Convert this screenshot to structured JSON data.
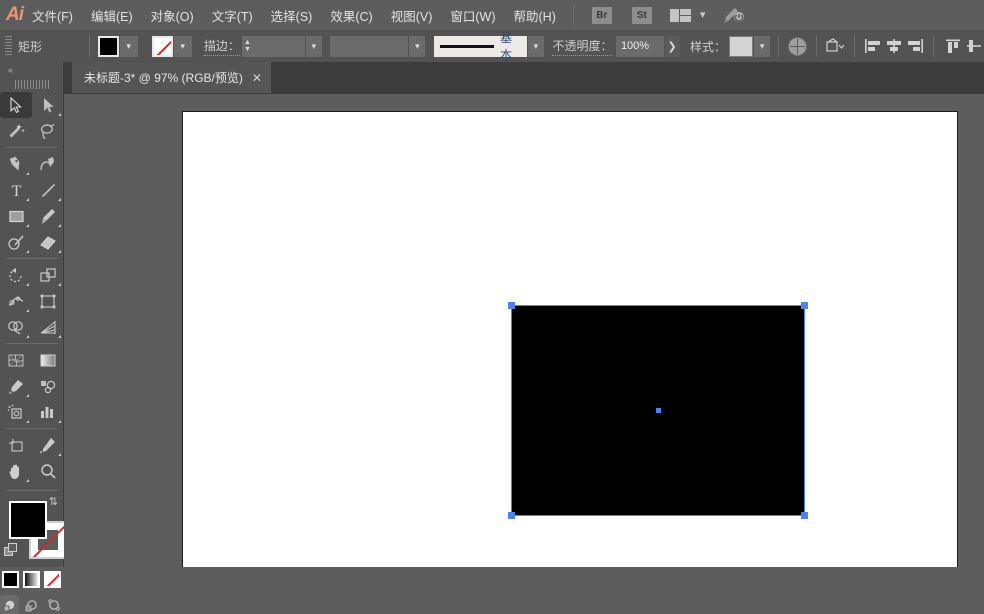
{
  "app": {
    "name": "Ai",
    "logo_color": "#e8956d"
  },
  "menubar": {
    "items": [
      {
        "label": "文件(F)",
        "name": "menu-file"
      },
      {
        "label": "编辑(E)",
        "name": "menu-edit"
      },
      {
        "label": "对象(O)",
        "name": "menu-object"
      },
      {
        "label": "文字(T)",
        "name": "menu-type"
      },
      {
        "label": "选择(S)",
        "name": "menu-select"
      },
      {
        "label": "效果(C)",
        "name": "menu-effect"
      },
      {
        "label": "视图(V)",
        "name": "menu-view"
      },
      {
        "label": "窗口(W)",
        "name": "menu-window"
      },
      {
        "label": "帮助(H)",
        "name": "menu-help"
      }
    ],
    "bridge_label": "Br",
    "stock_label": "St",
    "arrange_icon": "arrange-documents-icon",
    "chevron_icon": "chevron-down-icon",
    "rocket_icon": "rocket-power-icon"
  },
  "controlbar": {
    "grip_icon": "panel-grip-icon",
    "object_label": "矩形",
    "fill_swatch": {
      "name": "fill-color-swatch",
      "color": "#000000"
    },
    "stroke_swatch": {
      "name": "stroke-color-swatch",
      "color": "none"
    },
    "stroke_label": "描边：",
    "stroke_weight_value": "",
    "brush_label": "基本",
    "opacity_label": "不透明度：",
    "opacity_value": "100%",
    "opacity_more_icon": "chevron-right-icon",
    "style_label": "样式：",
    "style_swatch_color": "#d4d4d4",
    "recolor_icon": "recolor-artwork-icon",
    "transform_icon": "transform-shape-icon",
    "align_left_icon": "align-left-icon",
    "align_center_h_icon": "align-center-horizontal-icon",
    "align_right_icon": "align-right-icon",
    "align_top_icon": "align-top-icon",
    "align_center_v_icon": "align-center-vertical-icon",
    "dropdown_icon": "chevron-down-icon",
    "stepper_icon": "stepper-up-down-icon"
  },
  "tabs": [
    {
      "title": "未标题-3* @ 97% (RGB/预览)",
      "close_label": "✕",
      "active": true
    }
  ],
  "toolbar": {
    "collapse_icon": "double-chevron-left-icon",
    "grip_icon": "toolbar-grip-icon",
    "tools": [
      {
        "name": "tool-selection",
        "label": "选择工具",
        "active": true,
        "has_flyout": false
      },
      {
        "name": "tool-direct-selection",
        "label": "直接选择工具",
        "active": false,
        "has_flyout": true
      },
      {
        "name": "tool-magic-wand",
        "label": "魔棒工具",
        "active": false,
        "has_flyout": false
      },
      {
        "name": "tool-lasso",
        "label": "套索工具",
        "active": false,
        "has_flyout": false
      },
      {
        "name": "tool-pen",
        "label": "钢笔工具",
        "active": false,
        "has_flyout": true
      },
      {
        "name": "tool-curvature",
        "label": "曲率工具",
        "active": false,
        "has_flyout": false
      },
      {
        "name": "tool-type",
        "label": "文字工具",
        "active": false,
        "has_flyout": true
      },
      {
        "name": "tool-line-segment",
        "label": "直线段工具",
        "active": false,
        "has_flyout": true
      },
      {
        "name": "tool-rectangle",
        "label": "矩形工具",
        "active": false,
        "has_flyout": true
      },
      {
        "name": "tool-paintbrush",
        "label": "画笔工具",
        "active": false,
        "has_flyout": true
      },
      {
        "name": "tool-shaper",
        "label": "Shaper 工具",
        "active": false,
        "has_flyout": true
      },
      {
        "name": "tool-eraser",
        "label": "橡皮擦工具",
        "active": false,
        "has_flyout": true
      },
      {
        "name": "tool-rotate",
        "label": "旋转工具",
        "active": false,
        "has_flyout": true
      },
      {
        "name": "tool-scale",
        "label": "比例缩放工具",
        "active": false,
        "has_flyout": true
      },
      {
        "name": "tool-width",
        "label": "宽度工具",
        "active": false,
        "has_flyout": true
      },
      {
        "name": "tool-free-transform",
        "label": "自由变换工具",
        "active": false,
        "has_flyout": false
      },
      {
        "name": "tool-shape-builder",
        "label": "形状生成器工具",
        "active": false,
        "has_flyout": true
      },
      {
        "name": "tool-perspective-grid",
        "label": "透视网格工具",
        "active": false,
        "has_flyout": true
      },
      {
        "name": "tool-mesh",
        "label": "网格工具",
        "active": false,
        "has_flyout": false
      },
      {
        "name": "tool-gradient",
        "label": "渐变工具",
        "active": false,
        "has_flyout": false
      },
      {
        "name": "tool-eyedropper",
        "label": "吸管工具",
        "active": false,
        "has_flyout": true
      },
      {
        "name": "tool-blend",
        "label": "混合工具",
        "active": false,
        "has_flyout": false
      },
      {
        "name": "tool-symbol-sprayer",
        "label": "符号喷枪工具",
        "active": false,
        "has_flyout": true
      },
      {
        "name": "tool-column-graph",
        "label": "柱形图工具",
        "active": false,
        "has_flyout": true
      },
      {
        "name": "tool-artboard",
        "label": "画板工具",
        "active": false,
        "has_flyout": false
      },
      {
        "name": "tool-slice",
        "label": "切片工具",
        "active": false,
        "has_flyout": true
      },
      {
        "name": "tool-hand",
        "label": "抓手工具",
        "active": false,
        "has_flyout": true
      },
      {
        "name": "tool-zoom",
        "label": "缩放工具",
        "active": false,
        "has_flyout": false
      }
    ],
    "fill_color": "#000000",
    "stroke_color": "none",
    "swap_icon": "swap-fill-stroke-icon",
    "default_icon": "default-fill-stroke-icon",
    "color_mode_icon": "color-fill-icon",
    "gradient_mode_icon": "gradient-fill-icon",
    "none_mode_icon": "none-fill-icon",
    "draw_normal_icon": "draw-normal-icon",
    "draw_behind_icon": "draw-behind-icon",
    "draw_inside_icon": "draw-inside-icon"
  },
  "canvas": {
    "artboard_color": "#ffffff",
    "background_color": "#5d5d5d",
    "selection_color": "#4d82f0",
    "shape": {
      "name": "rectangle-shape",
      "fill": "#000000",
      "stroke": "none"
    }
  }
}
